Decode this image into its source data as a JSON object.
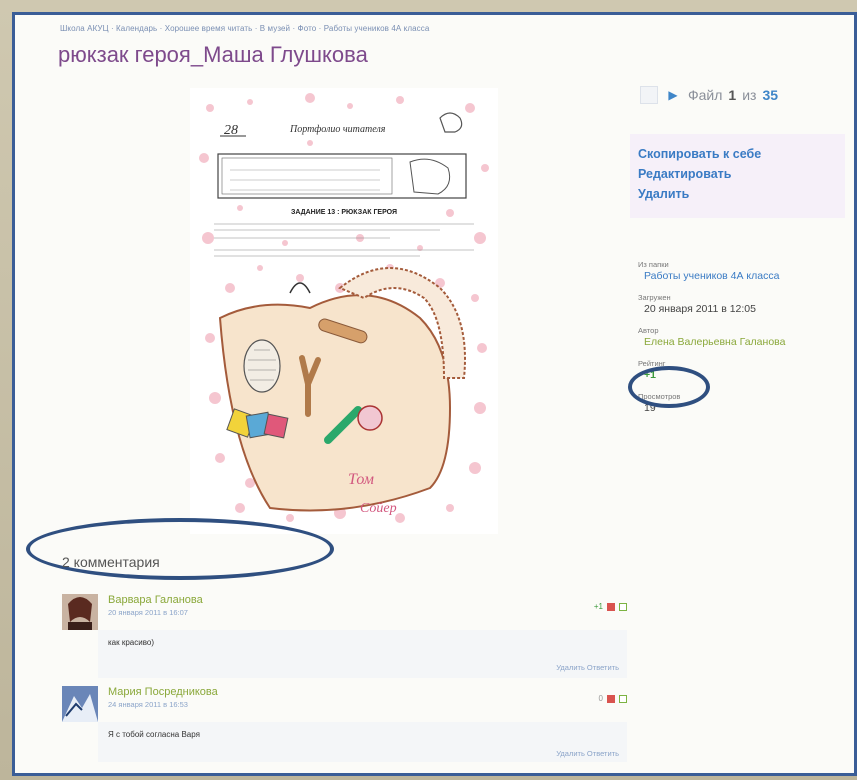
{
  "page": {
    "breadcrumb": "Школа АКУЦ · Календарь · Хорошее время читать · В музей · Фото · Работы учеников 4А класса",
    "title": "рюкзак героя_Маша Глушкова"
  },
  "drawing": {
    "page_number": "28",
    "header": "Портфолио читателя",
    "task": "ЗАДАНИЕ 13 : РЮКЗАК ГЕРОЯ",
    "signature_line1": "Том",
    "signature_line2": "Сойер"
  },
  "file_nav": {
    "prefix": "Файл",
    "current": "1",
    "separator": "из",
    "total": "35"
  },
  "actions": {
    "copy": "Скопировать к себе",
    "edit": "Редактировать",
    "delete": "Удалить"
  },
  "meta": {
    "folder_label": "Из папки",
    "folder_value": "Работы учеников 4А класса",
    "uploaded_label": "Загружен",
    "uploaded_value": "20 января 2011 в 12:05",
    "author_label": "Автор",
    "author_value": "Елена Валерьевна Галанова",
    "rating_label": "Рейтинг",
    "rating_value": "+1",
    "views_label": "Просмотров",
    "views_value": "19"
  },
  "comments": {
    "title": "2 комментария",
    "items": [
      {
        "author": "Варвара Галанова",
        "date": "20 января 2011 в 16:07",
        "vote": "+1",
        "text": "как красиво)",
        "links": "Удалить Ответить"
      },
      {
        "author": "Мария Посредникова",
        "date": "24 января 2011 в 16:53",
        "vote": "0",
        "text": "Я с тобой согласна Варя",
        "links": "Удалить Ответить"
      }
    ]
  },
  "colors": {
    "frame": "#3a5d97",
    "title": "#7e4a8c",
    "link": "#3a7bc4",
    "author": "#8aa83a"
  }
}
